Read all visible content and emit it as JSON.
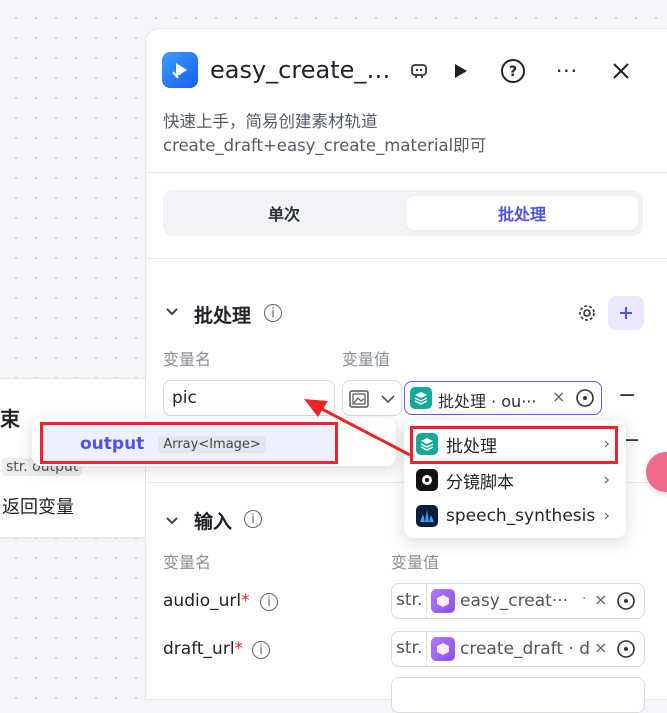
{
  "canvas": {
    "end_node": {
      "title": "束",
      "var_type": "str.",
      "var_name": "output",
      "return_label": "返回变量"
    }
  },
  "panel": {
    "title": "easy_create_…",
    "description": "快速上手，简易创建素材轨道 create_draft+easy_create_material即可",
    "tabs": [
      {
        "label": "单次"
      },
      {
        "label": "批处理"
      }
    ],
    "batch_section": {
      "title": "批处理",
      "col_name": "变量名",
      "col_value": "变量值",
      "var_name_value": "pic",
      "ref_label": "批处理 · ou···",
      "add_icon": "plus-icon",
      "remove_label": "−"
    },
    "input_section": {
      "title": "输入",
      "col_name": "变量名",
      "col_value": "变量值",
      "rows": [
        {
          "name": "audio_url",
          "required": "*",
          "type": "str.",
          "ref": "easy_creat···",
          "sep": "·",
          "close": "×"
        },
        {
          "name": "draft_url",
          "required": "*",
          "type": "str.",
          "ref": "create_draft · d",
          "sep": "",
          "close": "×"
        }
      ]
    }
  },
  "dropdown": {
    "items": [
      {
        "label": "批处理",
        "icon": "layers-icon"
      },
      {
        "label": "分镜脚本",
        "icon": "clapper-icon"
      },
      {
        "label": "speech_synthesis",
        "icon": "wave-icon"
      }
    ]
  },
  "output_popup": {
    "name": "output",
    "type": "Array<Image>"
  },
  "colors": {
    "accent": "#4d53e8",
    "highlight": "#e8262b",
    "teal": "#15a89b",
    "purple": "#8a4df0"
  }
}
